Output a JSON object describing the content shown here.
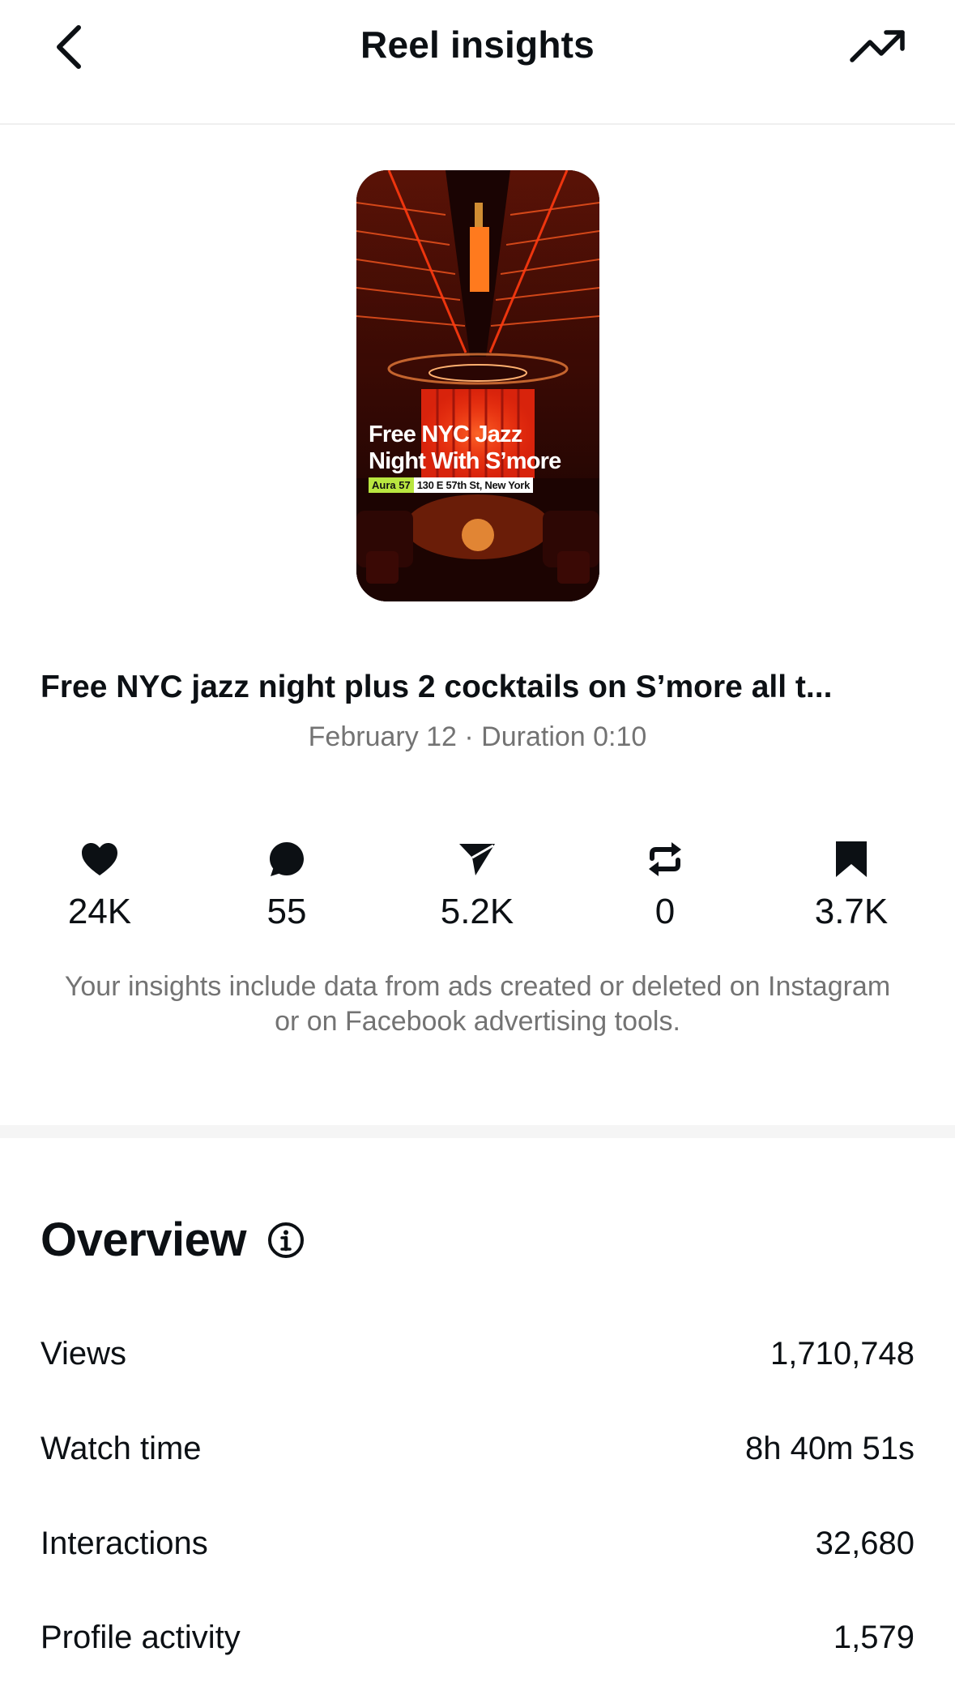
{
  "header": {
    "title": "Reel insights",
    "back_icon": "chevron-left-icon",
    "trend_icon": "trending-up-icon"
  },
  "reel": {
    "thumbnail": {
      "line1": "Free NYC Jazz",
      "line2": "Night With S’more",
      "venue": "Aura 57",
      "address": "130 E 57th St, New York"
    },
    "title": "Free NYC jazz night plus 2 cocktails on S’more all t...",
    "meta": "February 12 · Duration 0:10"
  },
  "stats": [
    {
      "icon": "heart-icon",
      "value": "24K"
    },
    {
      "icon": "comment-icon",
      "value": "55"
    },
    {
      "icon": "share-icon",
      "value": "5.2K"
    },
    {
      "icon": "repost-icon",
      "value": "0"
    },
    {
      "icon": "bookmark-icon",
      "value": "3.7K"
    }
  ],
  "disclaimer": "Your insights include data from ads created or deleted on Instagram or on Facebook advertising tools.",
  "overview": {
    "title": "Overview",
    "info_icon": "info-icon",
    "rows": [
      {
        "label": "Views",
        "value": "1,710,748"
      },
      {
        "label": "Watch time",
        "value": "8h 40m 51s"
      },
      {
        "label": "Interactions",
        "value": "32,680"
      },
      {
        "label": "Profile activity",
        "value": "1,579"
      }
    ]
  },
  "colors": {
    "text": "#0c1014",
    "secondary_text": "#737373",
    "divider": "#efefef",
    "band": "#f5f5f5",
    "tag_green": "#b9e640"
  }
}
